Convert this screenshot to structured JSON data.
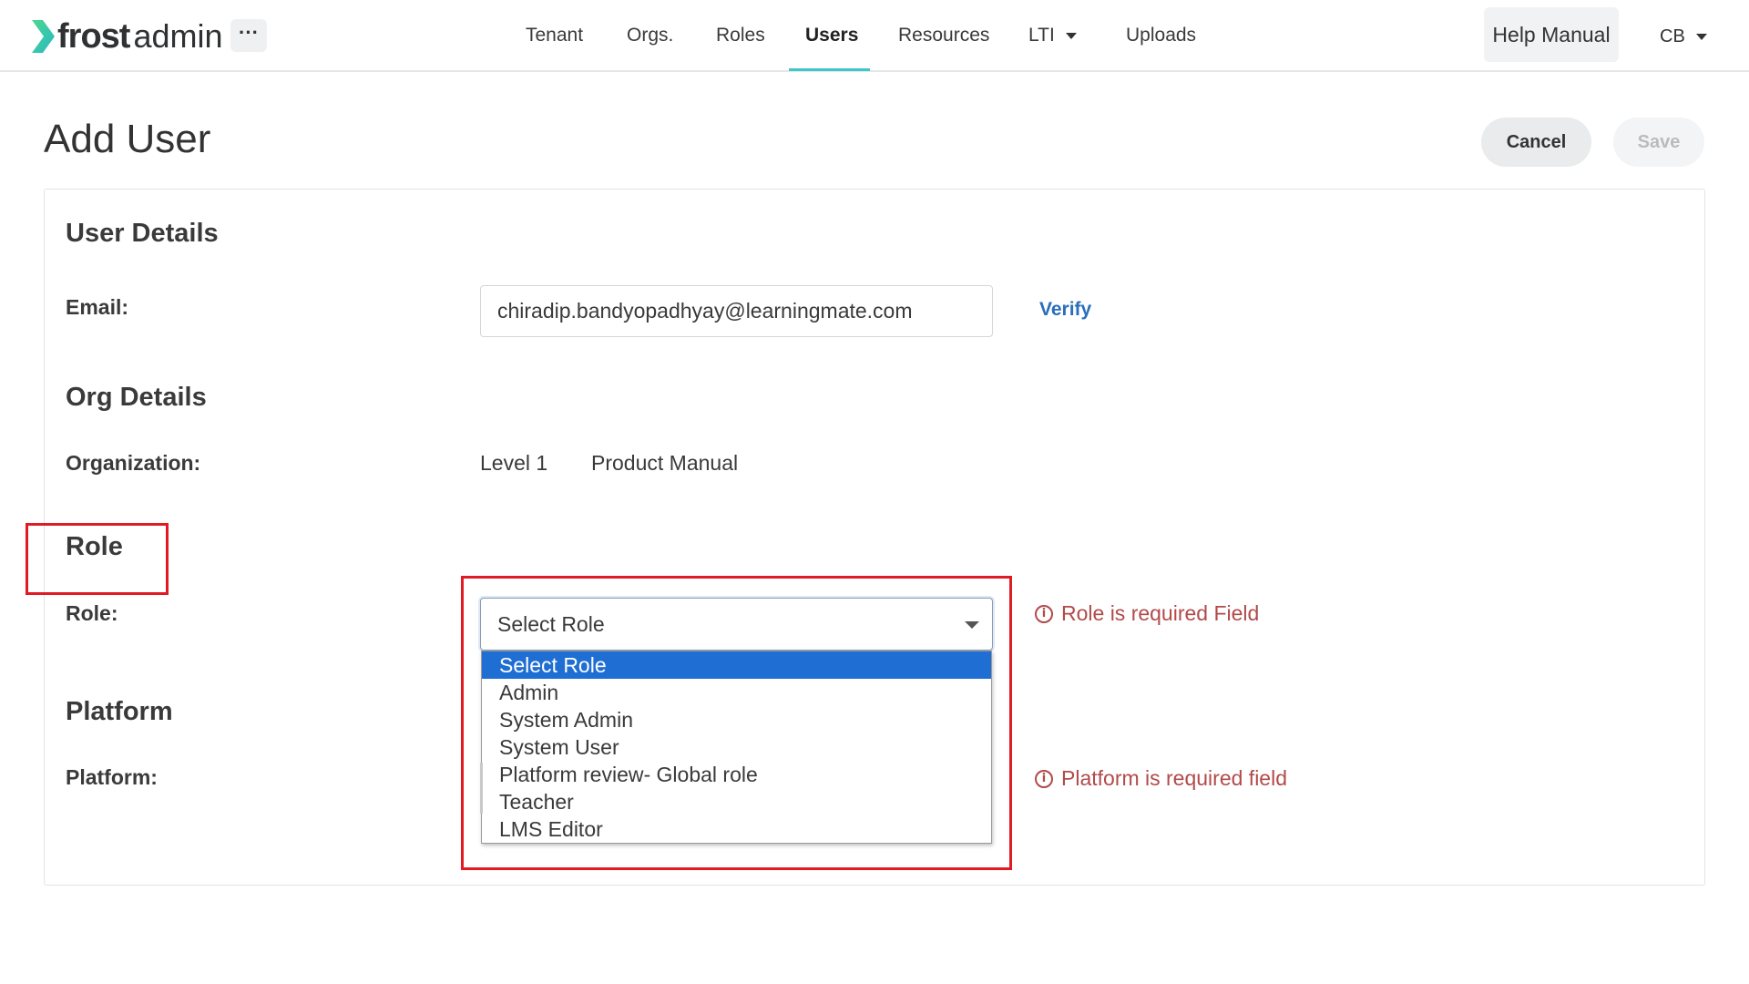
{
  "app": {
    "logo_primary": "frost",
    "logo_secondary": "admin",
    "more_label": "···"
  },
  "nav": {
    "items": [
      {
        "label": "Tenant"
      },
      {
        "label": "Orgs."
      },
      {
        "label": "Roles"
      },
      {
        "label": "Users",
        "active": true
      },
      {
        "label": "Resources"
      },
      {
        "label": "LTI",
        "has_dropdown": true
      },
      {
        "label": "Uploads"
      }
    ],
    "help_label": "Help Manual",
    "user_initials": "CB"
  },
  "page": {
    "title": "Add User",
    "cancel_label": "Cancel",
    "save_label": "Save"
  },
  "user_details": {
    "section_title": "User Details",
    "email_label": "Email:",
    "email_value": "chiradip.bandyopadhyay@learningmate.com",
    "verify_label": "Verify"
  },
  "org_details": {
    "section_title": "Org Details",
    "organization_label": "Organization:",
    "level_value": "Level 1",
    "org_value": "Product Manual"
  },
  "role": {
    "section_title": "Role",
    "role_label": "Role:",
    "selected_value": "Select Role",
    "options": [
      "Select Role",
      "Admin",
      "System Admin",
      "System User",
      "Platform review- Global role",
      "Teacher",
      "LMS Editor"
    ],
    "error": "Role is required Field"
  },
  "platform": {
    "section_title": "Platform",
    "platform_label": "Platform:",
    "error": "Platform is required field"
  },
  "colors": {
    "accent": "#3ec7c9",
    "logo_green": "#4cd88b",
    "logo_teal": "#28b8c7",
    "link": "#2a6ebb",
    "error": "#b24a4a",
    "highlight": "#e01b24",
    "selected_option": "#1f6ed4"
  }
}
